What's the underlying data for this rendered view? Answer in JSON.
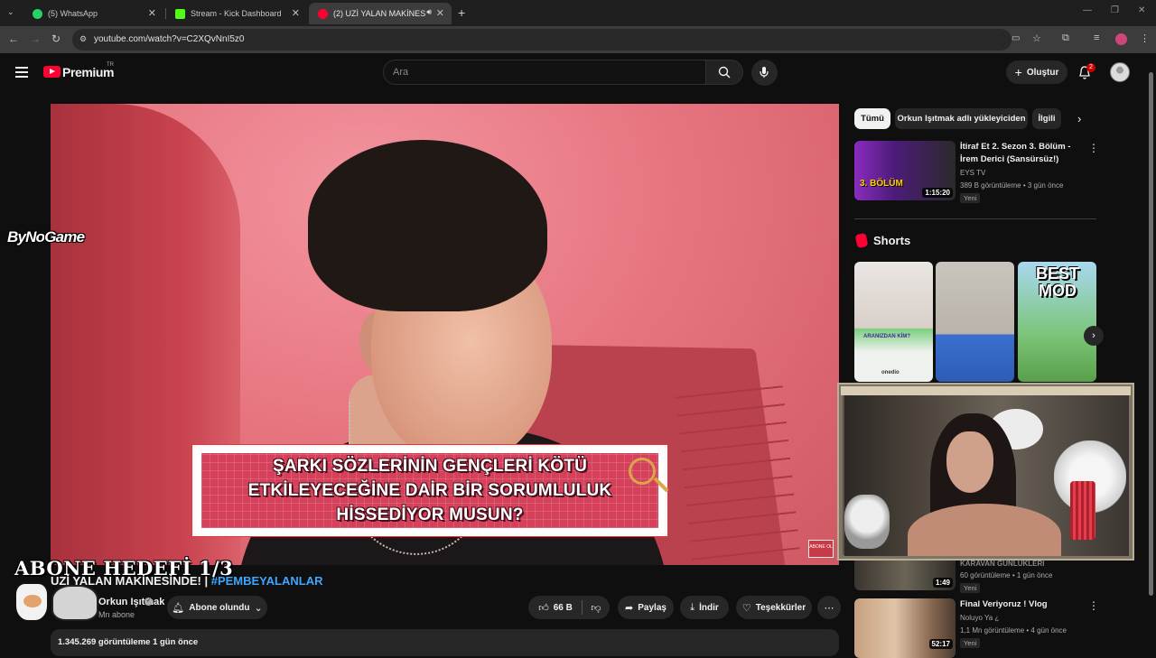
{
  "browser": {
    "tabs": [
      {
        "label": "(5) WhatsApp",
        "color": "#25d366"
      },
      {
        "label": "Stream - Kick Dashboard",
        "color": "#53fc18"
      },
      {
        "label": "(2) UZİ YALAN MAKİNESİN",
        "color": "#ff0033"
      }
    ],
    "new_tab": "+",
    "url": "youtube.com/watch?v=C2XQvNnI5z0"
  },
  "header": {
    "logo": "Premium",
    "logo_region": "TR",
    "search_placeholder": "Ara",
    "create_label": "Oluştur",
    "notif_count": "2"
  },
  "player": {
    "watermark_a": "ByNo",
    "watermark_b": "Game",
    "caption_lines": [
      "ŞARKI SÖZLERİNİN GENÇLERİ KÖTÜ",
      "ETKİLEYECEĞİNE DAİR BİR SORUMLULUK",
      "HİSSEDİYOR MUSUN?"
    ],
    "endcard_label": "ABONE OL"
  },
  "overlay": {
    "abone_hedefi": "ABONE HEDEFİ 1/3"
  },
  "video": {
    "title_prefix": "UZİ YALAN MAKİNESİNDE! | ",
    "title_hashtag": "#PEMBEYALANLAR",
    "channel_name": "Orkun Işıtmak",
    "subscribers": "Mn abone",
    "subscribed_label": "Abone olundu",
    "like_count": "66 B",
    "share_label": "Paylaş",
    "download_label": "İndir",
    "thanks_label": "Teşekkürler",
    "views_line": "1.345.269 görüntüleme  1 gün önce"
  },
  "sidebar": {
    "chips": [
      "Tümü",
      "Orkun Işıtmak adlı yükleyiciden",
      "İlgili"
    ],
    "recs": [
      {
        "title": "İtiraf Et 2. Sezon 3. Bölüm - İrem Derici (Sansürsüz!)",
        "channel": "EYS TV",
        "meta": "389 B görüntüleme • 3 gün önce",
        "badge": "Yeni",
        "duration": "1:15:20",
        "thumb_text": "3. BÖLÜM"
      },
      {
        "title": "KARAVAN GÜNLÜKLERİ",
        "channel": "",
        "meta": "60 görüntüleme • 1 gün önce",
        "badge": "Yeni",
        "duration": "1:49"
      },
      {
        "title": "Final Veriyoruz ! Vlog",
        "channel": "Noluyo Ya ¿",
        "meta": "1,1 Mn görüntüleme • 4 gün önce",
        "badge": "Yeni",
        "duration": "52:17"
      }
    ],
    "shorts_title": "Shorts",
    "shorts": [
      {
        "label": "ARANIZDAN KİM?",
        "sub": "onedio"
      },
      {
        "label": "",
        "sub": ""
      },
      {
        "label": "BEST MOD",
        "sub": ""
      }
    ]
  },
  "colors": {
    "accent_red": "#ff0033",
    "link_blue": "#3ea6ff",
    "bg": "#0f0f0f"
  }
}
